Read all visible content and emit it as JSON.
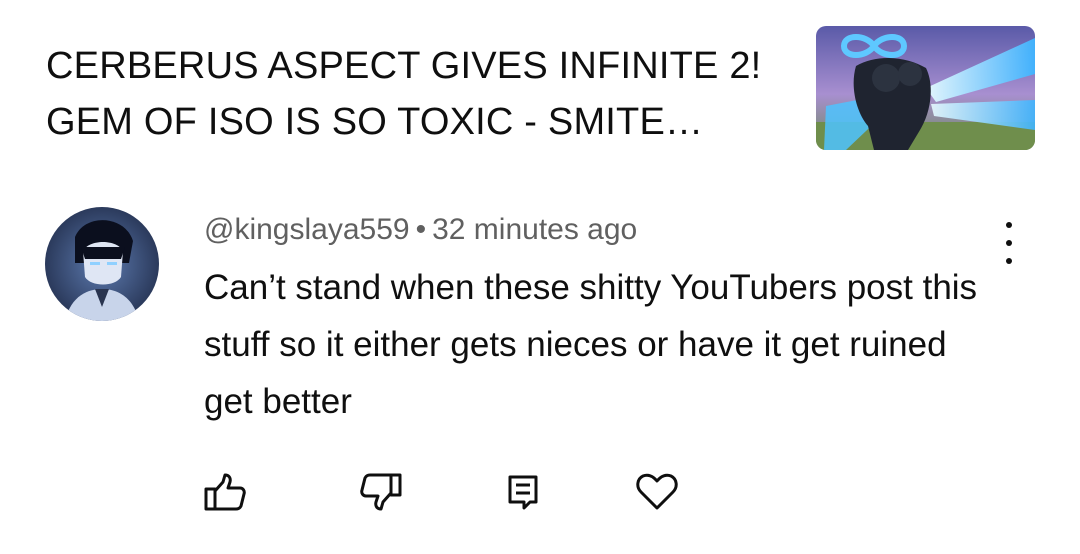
{
  "video": {
    "title": "CERBERUS ASPECT GIVES INFINITE 2! GEM OF ISO IS SO TOXIC - SMITE…",
    "thumbnail_icon": "infinity-icon"
  },
  "comment": {
    "author": "@kingslaya559",
    "separator": "•",
    "time": "32 minutes ago",
    "text": "Can’t stand when these shitty YouTubers post this stuff so it either gets nieces or have it get ruined get better"
  },
  "actions": {
    "like_icon": "thumbs-up-icon",
    "dislike_icon": "thumbs-down-icon",
    "reply_icon": "reply-icon",
    "heart_icon": "heart-icon",
    "more_icon": "more-vert-icon"
  },
  "colors": {
    "text_primary": "#0f0f0f",
    "text_secondary": "#606060",
    "background": "#ffffff"
  }
}
